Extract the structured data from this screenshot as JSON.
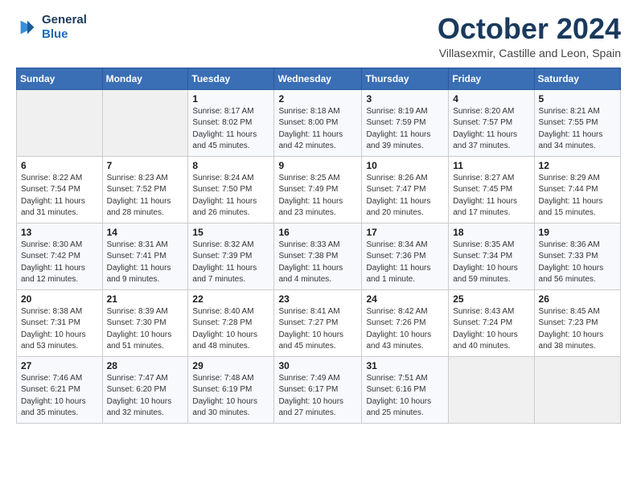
{
  "header": {
    "logo_general": "General",
    "logo_blue": "Blue",
    "month": "October 2024",
    "location": "Villasexmir, Castille and Leon, Spain"
  },
  "days_of_week": [
    "Sunday",
    "Monday",
    "Tuesday",
    "Wednesday",
    "Thursday",
    "Friday",
    "Saturday"
  ],
  "weeks": [
    [
      {
        "day": "",
        "info": ""
      },
      {
        "day": "",
        "info": ""
      },
      {
        "day": "1",
        "info": "Sunrise: 8:17 AM\nSunset: 8:02 PM\nDaylight: 11 hours and 45 minutes."
      },
      {
        "day": "2",
        "info": "Sunrise: 8:18 AM\nSunset: 8:00 PM\nDaylight: 11 hours and 42 minutes."
      },
      {
        "day": "3",
        "info": "Sunrise: 8:19 AM\nSunset: 7:59 PM\nDaylight: 11 hours and 39 minutes."
      },
      {
        "day": "4",
        "info": "Sunrise: 8:20 AM\nSunset: 7:57 PM\nDaylight: 11 hours and 37 minutes."
      },
      {
        "day": "5",
        "info": "Sunrise: 8:21 AM\nSunset: 7:55 PM\nDaylight: 11 hours and 34 minutes."
      }
    ],
    [
      {
        "day": "6",
        "info": "Sunrise: 8:22 AM\nSunset: 7:54 PM\nDaylight: 11 hours and 31 minutes."
      },
      {
        "day": "7",
        "info": "Sunrise: 8:23 AM\nSunset: 7:52 PM\nDaylight: 11 hours and 28 minutes."
      },
      {
        "day": "8",
        "info": "Sunrise: 8:24 AM\nSunset: 7:50 PM\nDaylight: 11 hours and 26 minutes."
      },
      {
        "day": "9",
        "info": "Sunrise: 8:25 AM\nSunset: 7:49 PM\nDaylight: 11 hours and 23 minutes."
      },
      {
        "day": "10",
        "info": "Sunrise: 8:26 AM\nSunset: 7:47 PM\nDaylight: 11 hours and 20 minutes."
      },
      {
        "day": "11",
        "info": "Sunrise: 8:27 AM\nSunset: 7:45 PM\nDaylight: 11 hours and 17 minutes."
      },
      {
        "day": "12",
        "info": "Sunrise: 8:29 AM\nSunset: 7:44 PM\nDaylight: 11 hours and 15 minutes."
      }
    ],
    [
      {
        "day": "13",
        "info": "Sunrise: 8:30 AM\nSunset: 7:42 PM\nDaylight: 11 hours and 12 minutes."
      },
      {
        "day": "14",
        "info": "Sunrise: 8:31 AM\nSunset: 7:41 PM\nDaylight: 11 hours and 9 minutes."
      },
      {
        "day": "15",
        "info": "Sunrise: 8:32 AM\nSunset: 7:39 PM\nDaylight: 11 hours and 7 minutes."
      },
      {
        "day": "16",
        "info": "Sunrise: 8:33 AM\nSunset: 7:38 PM\nDaylight: 11 hours and 4 minutes."
      },
      {
        "day": "17",
        "info": "Sunrise: 8:34 AM\nSunset: 7:36 PM\nDaylight: 11 hours and 1 minute."
      },
      {
        "day": "18",
        "info": "Sunrise: 8:35 AM\nSunset: 7:34 PM\nDaylight: 10 hours and 59 minutes."
      },
      {
        "day": "19",
        "info": "Sunrise: 8:36 AM\nSunset: 7:33 PM\nDaylight: 10 hours and 56 minutes."
      }
    ],
    [
      {
        "day": "20",
        "info": "Sunrise: 8:38 AM\nSunset: 7:31 PM\nDaylight: 10 hours and 53 minutes."
      },
      {
        "day": "21",
        "info": "Sunrise: 8:39 AM\nSunset: 7:30 PM\nDaylight: 10 hours and 51 minutes."
      },
      {
        "day": "22",
        "info": "Sunrise: 8:40 AM\nSunset: 7:28 PM\nDaylight: 10 hours and 48 minutes."
      },
      {
        "day": "23",
        "info": "Sunrise: 8:41 AM\nSunset: 7:27 PM\nDaylight: 10 hours and 45 minutes."
      },
      {
        "day": "24",
        "info": "Sunrise: 8:42 AM\nSunset: 7:26 PM\nDaylight: 10 hours and 43 minutes."
      },
      {
        "day": "25",
        "info": "Sunrise: 8:43 AM\nSunset: 7:24 PM\nDaylight: 10 hours and 40 minutes."
      },
      {
        "day": "26",
        "info": "Sunrise: 8:45 AM\nSunset: 7:23 PM\nDaylight: 10 hours and 38 minutes."
      }
    ],
    [
      {
        "day": "27",
        "info": "Sunrise: 7:46 AM\nSunset: 6:21 PM\nDaylight: 10 hours and 35 minutes."
      },
      {
        "day": "28",
        "info": "Sunrise: 7:47 AM\nSunset: 6:20 PM\nDaylight: 10 hours and 32 minutes."
      },
      {
        "day": "29",
        "info": "Sunrise: 7:48 AM\nSunset: 6:19 PM\nDaylight: 10 hours and 30 minutes."
      },
      {
        "day": "30",
        "info": "Sunrise: 7:49 AM\nSunset: 6:17 PM\nDaylight: 10 hours and 27 minutes."
      },
      {
        "day": "31",
        "info": "Sunrise: 7:51 AM\nSunset: 6:16 PM\nDaylight: 10 hours and 25 minutes."
      },
      {
        "day": "",
        "info": ""
      },
      {
        "day": "",
        "info": ""
      }
    ]
  ]
}
